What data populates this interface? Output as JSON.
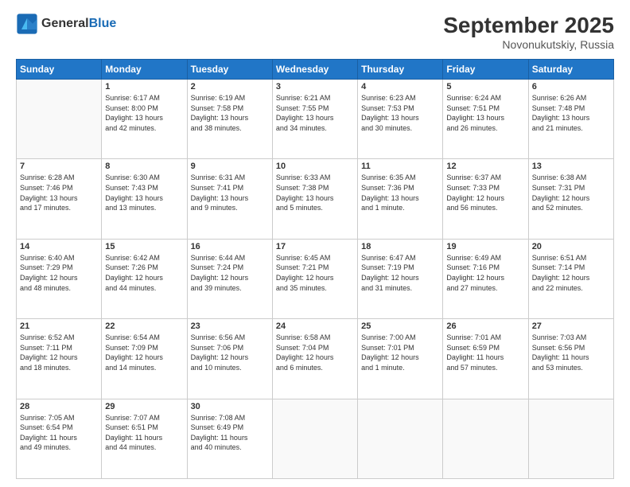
{
  "header": {
    "logo_general": "General",
    "logo_blue": "Blue",
    "month_year": "September 2025",
    "location": "Novonukutskiy, Russia"
  },
  "weekdays": [
    "Sunday",
    "Monday",
    "Tuesday",
    "Wednesday",
    "Thursday",
    "Friday",
    "Saturday"
  ],
  "weeks": [
    [
      {
        "day": "",
        "info": ""
      },
      {
        "day": "1",
        "info": "Sunrise: 6:17 AM\nSunset: 8:00 PM\nDaylight: 13 hours\nand 42 minutes."
      },
      {
        "day": "2",
        "info": "Sunrise: 6:19 AM\nSunset: 7:58 PM\nDaylight: 13 hours\nand 38 minutes."
      },
      {
        "day": "3",
        "info": "Sunrise: 6:21 AM\nSunset: 7:55 PM\nDaylight: 13 hours\nand 34 minutes."
      },
      {
        "day": "4",
        "info": "Sunrise: 6:23 AM\nSunset: 7:53 PM\nDaylight: 13 hours\nand 30 minutes."
      },
      {
        "day": "5",
        "info": "Sunrise: 6:24 AM\nSunset: 7:51 PM\nDaylight: 13 hours\nand 26 minutes."
      },
      {
        "day": "6",
        "info": "Sunrise: 6:26 AM\nSunset: 7:48 PM\nDaylight: 13 hours\nand 21 minutes."
      }
    ],
    [
      {
        "day": "7",
        "info": "Sunrise: 6:28 AM\nSunset: 7:46 PM\nDaylight: 13 hours\nand 17 minutes."
      },
      {
        "day": "8",
        "info": "Sunrise: 6:30 AM\nSunset: 7:43 PM\nDaylight: 13 hours\nand 13 minutes."
      },
      {
        "day": "9",
        "info": "Sunrise: 6:31 AM\nSunset: 7:41 PM\nDaylight: 13 hours\nand 9 minutes."
      },
      {
        "day": "10",
        "info": "Sunrise: 6:33 AM\nSunset: 7:38 PM\nDaylight: 13 hours\nand 5 minutes."
      },
      {
        "day": "11",
        "info": "Sunrise: 6:35 AM\nSunset: 7:36 PM\nDaylight: 13 hours\nand 1 minute."
      },
      {
        "day": "12",
        "info": "Sunrise: 6:37 AM\nSunset: 7:33 PM\nDaylight: 12 hours\nand 56 minutes."
      },
      {
        "day": "13",
        "info": "Sunrise: 6:38 AM\nSunset: 7:31 PM\nDaylight: 12 hours\nand 52 minutes."
      }
    ],
    [
      {
        "day": "14",
        "info": "Sunrise: 6:40 AM\nSunset: 7:29 PM\nDaylight: 12 hours\nand 48 minutes."
      },
      {
        "day": "15",
        "info": "Sunrise: 6:42 AM\nSunset: 7:26 PM\nDaylight: 12 hours\nand 44 minutes."
      },
      {
        "day": "16",
        "info": "Sunrise: 6:44 AM\nSunset: 7:24 PM\nDaylight: 12 hours\nand 39 minutes."
      },
      {
        "day": "17",
        "info": "Sunrise: 6:45 AM\nSunset: 7:21 PM\nDaylight: 12 hours\nand 35 minutes."
      },
      {
        "day": "18",
        "info": "Sunrise: 6:47 AM\nSunset: 7:19 PM\nDaylight: 12 hours\nand 31 minutes."
      },
      {
        "day": "19",
        "info": "Sunrise: 6:49 AM\nSunset: 7:16 PM\nDaylight: 12 hours\nand 27 minutes."
      },
      {
        "day": "20",
        "info": "Sunrise: 6:51 AM\nSunset: 7:14 PM\nDaylight: 12 hours\nand 22 minutes."
      }
    ],
    [
      {
        "day": "21",
        "info": "Sunrise: 6:52 AM\nSunset: 7:11 PM\nDaylight: 12 hours\nand 18 minutes."
      },
      {
        "day": "22",
        "info": "Sunrise: 6:54 AM\nSunset: 7:09 PM\nDaylight: 12 hours\nand 14 minutes."
      },
      {
        "day": "23",
        "info": "Sunrise: 6:56 AM\nSunset: 7:06 PM\nDaylight: 12 hours\nand 10 minutes."
      },
      {
        "day": "24",
        "info": "Sunrise: 6:58 AM\nSunset: 7:04 PM\nDaylight: 12 hours\nand 6 minutes."
      },
      {
        "day": "25",
        "info": "Sunrise: 7:00 AM\nSunset: 7:01 PM\nDaylight: 12 hours\nand 1 minute."
      },
      {
        "day": "26",
        "info": "Sunrise: 7:01 AM\nSunset: 6:59 PM\nDaylight: 11 hours\nand 57 minutes."
      },
      {
        "day": "27",
        "info": "Sunrise: 7:03 AM\nSunset: 6:56 PM\nDaylight: 11 hours\nand 53 minutes."
      }
    ],
    [
      {
        "day": "28",
        "info": "Sunrise: 7:05 AM\nSunset: 6:54 PM\nDaylight: 11 hours\nand 49 minutes."
      },
      {
        "day": "29",
        "info": "Sunrise: 7:07 AM\nSunset: 6:51 PM\nDaylight: 11 hours\nand 44 minutes."
      },
      {
        "day": "30",
        "info": "Sunrise: 7:08 AM\nSunset: 6:49 PM\nDaylight: 11 hours\nand 40 minutes."
      },
      {
        "day": "",
        "info": ""
      },
      {
        "day": "",
        "info": ""
      },
      {
        "day": "",
        "info": ""
      },
      {
        "day": "",
        "info": ""
      }
    ]
  ]
}
